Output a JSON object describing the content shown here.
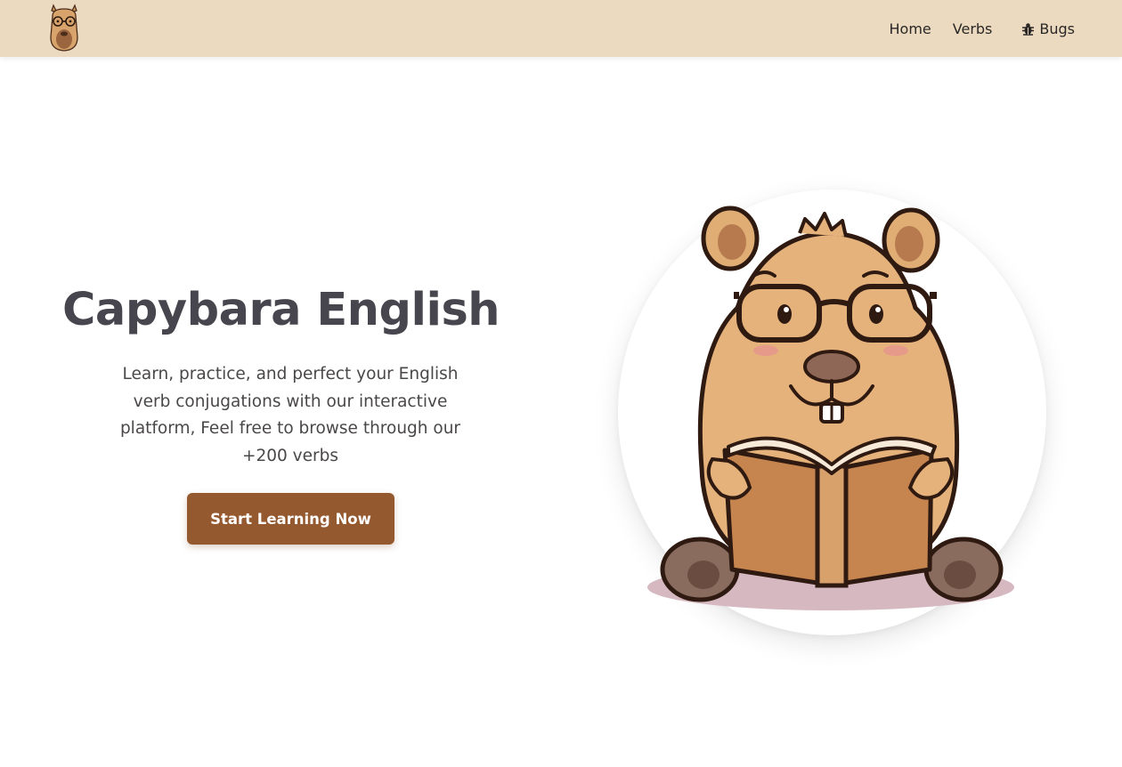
{
  "navbar": {
    "logo": {
      "icon": "capybara-logo-icon"
    },
    "links": [
      {
        "label": "Home"
      },
      {
        "label": "Verbs"
      },
      {
        "label": "Bugs",
        "icon": "bug-icon"
      }
    ]
  },
  "hero": {
    "title": "Capybara English",
    "description": "Learn, practice, and perfect your English verb conjugations with our interactive platform, Feel free to browse through our +200 verbs",
    "cta_label": "Start Learning Now",
    "illustration": "capybara-reading-book-illustration"
  },
  "colors": {
    "navbar_bg": "#ecdac0",
    "button_bg": "#95592f",
    "title": "#47454d",
    "text": "#4a4748"
  }
}
